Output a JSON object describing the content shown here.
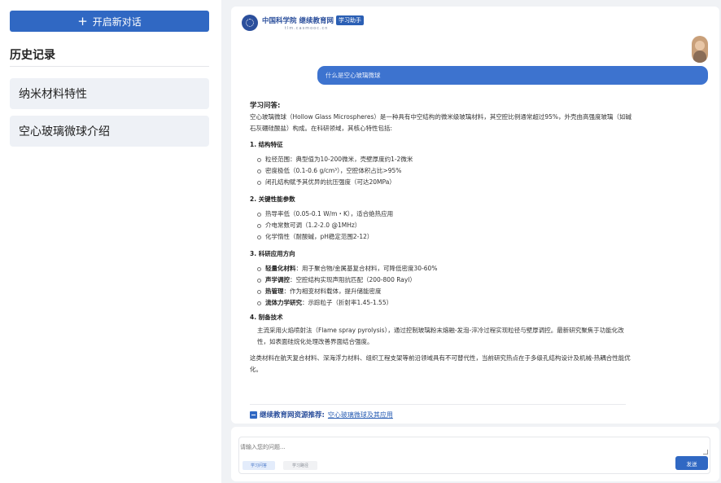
{
  "sidebar": {
    "new_chat_icon": "+",
    "new_chat_label": "开启新对话",
    "history_title": "历史记录",
    "history_items": [
      "纳米材料特性",
      "空心玻璃微球介绍"
    ]
  },
  "header": {
    "brand_name": "中国科学院",
    "brand_sub": "继续教育网",
    "badge": "学习助手",
    "url": "tlm.casmooc.cn"
  },
  "chat": {
    "user_question": "什么是空心玻璃微球",
    "answer_title": "学习问答:",
    "intro": "空心玻璃微球（Hollow Glass Microspheres）是一种具有中空结构的微米级玻璃材料，其空腔比例通常超过95%，外壳由高强度玻璃（如碱石灰硼硅酸盐）构成。在科研领域，其核心特性包括:",
    "sections": [
      {
        "title": "1. 结构特征",
        "items": [
          {
            "bold": "",
            "text": "粒径范围：典型值为10-200微米，壳壁厚度约1-2微米"
          },
          {
            "bold": "",
            "text": "密度极低（0.1-0.6 g/cm³），空腔体积占比>95%"
          },
          {
            "bold": "",
            "text": "闭孔结构赋予其优异的抗压强度（可达20MPa）"
          }
        ]
      },
      {
        "title": "2. 关键性能参数",
        "items": [
          {
            "bold": "",
            "text": "热导率低（0.05-0.1 W/m・K），适合绝热应用"
          },
          {
            "bold": "",
            "text": "介电常数可调（1.2-2.0 @1MHz）"
          },
          {
            "bold": "",
            "text": "化学惰性（耐酸碱，pH稳定范围2-12）"
          }
        ]
      },
      {
        "title": "3. 科研应用方向",
        "items": [
          {
            "bold": "轻量化材料",
            "text": "：用于聚合物/金属基复合材料，可降低密度30-60%"
          },
          {
            "bold": "声学调控",
            "text": "：空腔结构实现声阻抗匹配（200-800 Rayl）"
          },
          {
            "bold": "热管理",
            "text": "：作为相变材料载体，提升储能密度"
          },
          {
            "bold": "流体力学研究",
            "text": "：示踪粒子（折射率1.45-1.55）"
          }
        ]
      }
    ],
    "prep_title": "4. 制备技术",
    "prep_text": "主流采用火焰喷射法（Flame spray pyrolysis），通过控制玻璃粉末熔融-发泡-淬冷过程实现粒径与壁厚调控。最新研究聚焦于功能化改性，如表面硅烷化处理改善界面结合强度。",
    "conclusion": "这类材料在航天复合材料、深海浮力材料、组织工程支架等前沿领域具有不可替代性，当前研究热点在于多级孔结构设计及机械-热耦合性能优化。",
    "rec_label": "继续教育网资源推荐:",
    "rec_link": "空心玻璃微球及其应用"
  },
  "input": {
    "placeholder": "请输入您的问题...",
    "chip1": "学习问答",
    "chip2": "学习路径",
    "send": "发送"
  },
  "colors": {
    "primary": "#3068c3",
    "bubble": "#3d73cf",
    "brand": "#2b4f9c",
    "history_bg": "#eef1f6",
    "page_bg": "#f0f2f5"
  }
}
